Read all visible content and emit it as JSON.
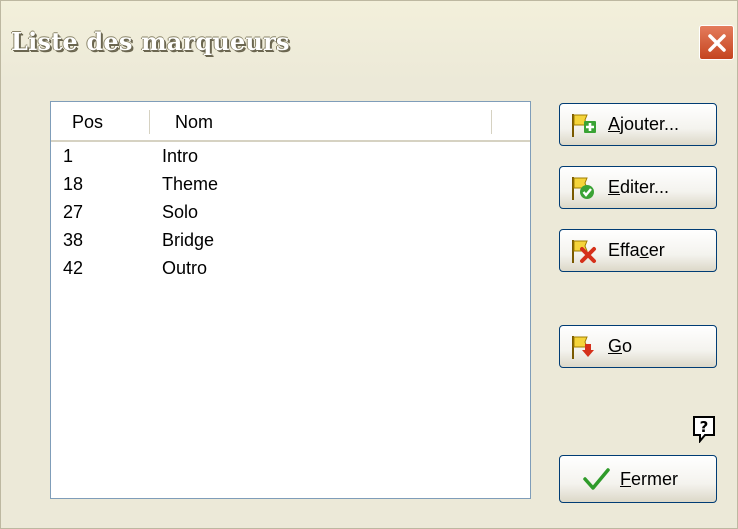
{
  "window": {
    "title": "Liste des marqueurs"
  },
  "list": {
    "columns": [
      "Pos",
      "Nom"
    ],
    "rows": [
      {
        "pos": "1",
        "nom": "Intro"
      },
      {
        "pos": "18",
        "nom": "Theme"
      },
      {
        "pos": "27",
        "nom": "Solo"
      },
      {
        "pos": "38",
        "nom": "Bridge"
      },
      {
        "pos": "42",
        "nom": "Outro"
      }
    ]
  },
  "buttons": {
    "ajouter": {
      "pre": "",
      "key": "A",
      "post": "jouter...",
      "icon": "flag-add-icon"
    },
    "editer": {
      "pre": "",
      "key": "E",
      "post": "diter...",
      "icon": "flag-check-icon"
    },
    "effacer": {
      "pre": "Effa",
      "key": "c",
      "post": "er",
      "icon": "flag-delete-icon"
    },
    "go": {
      "pre": "",
      "key": "G",
      "post": "o",
      "icon": "flag-go-icon"
    },
    "fermer": {
      "pre": "",
      "key": "F",
      "post": "ermer",
      "icon": "checkmark-icon"
    }
  },
  "colors": {
    "dialog_bg": "#ece9d8",
    "close_red": "#c5441f",
    "button_border": "#003c74",
    "list_border": "#7f9db9"
  }
}
